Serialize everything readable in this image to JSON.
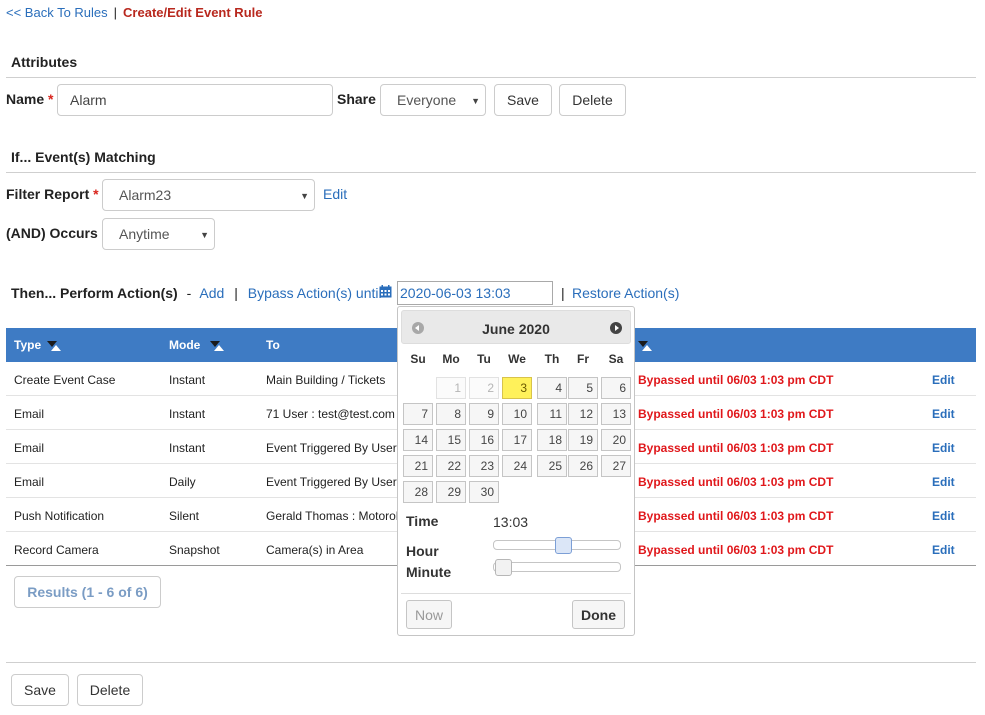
{
  "breadcrumb": {
    "back": "<< Back To Rules",
    "sep": "|",
    "current": "Create/Edit Event Rule"
  },
  "attributes": {
    "title": "Attributes",
    "name_label": "Name",
    "required_mark": "*",
    "name_value": "Alarm",
    "share_label": "Share",
    "share_value": "Everyone",
    "save": "Save",
    "delete": "Delete"
  },
  "matching": {
    "title": "If... Event(s) Matching",
    "filter_label": "Filter Report",
    "filter_value": "Alarm23",
    "edit": "Edit",
    "occurs_label": "(AND) Occurs",
    "occurs_value": "Anytime"
  },
  "actions": {
    "title": "Then... Perform Action(s)",
    "dash": "-",
    "add": "Add",
    "sep": "|",
    "bypass": "Bypass Action(s) until",
    "bypass_value": "2020-06-03 13:03",
    "restore": "Restore Action(s)"
  },
  "table": {
    "columns": {
      "type": "Type",
      "mode": "Mode",
      "to": "To"
    },
    "rows": [
      {
        "type": "Create Event Case",
        "mode": "Instant",
        "to": "Main Building / Tickets",
        "status": "Bypassed until 06/03 1:03 pm CDT",
        "action": "Edit"
      },
      {
        "type": "Email",
        "mode": "Instant",
        "to": "71 User : test@test.com",
        "status": "Bypassed until 06/03 1:03 pm CDT",
        "action": "Edit"
      },
      {
        "type": "Email",
        "mode": "Instant",
        "to": "Event Triggered By User",
        "status": "Bypassed until 06/03 1:03 pm CDT",
        "action": "Edit"
      },
      {
        "type": "Email",
        "mode": "Daily",
        "to": "Event Triggered By User",
        "status": "Bypassed until 06/03 1:03 pm CDT",
        "action": "Edit"
      },
      {
        "type": "Push Notification",
        "mode": "Silent",
        "to": "Gerald Thomas : Motorol",
        "status": "Bypassed until 06/03 1:03 pm CDT",
        "action": "Edit"
      },
      {
        "type": "Record Camera",
        "mode": "Snapshot",
        "to": "Camera(s) in Area",
        "status": "Bypassed until 06/03 1:03 pm CDT",
        "action": "Edit"
      }
    ],
    "results": "Results (1 - 6 of 6)"
  },
  "datepicker": {
    "title": "June 2020",
    "weekdays": [
      "Su",
      "Mo",
      "Tu",
      "We",
      "Th",
      "Fr",
      "Sa"
    ],
    "days": [
      "1",
      "2",
      "3",
      "4",
      "5",
      "6",
      "7",
      "8",
      "9",
      "10",
      "11",
      "12",
      "13",
      "14",
      "15",
      "16",
      "17",
      "18",
      "19",
      "20",
      "21",
      "22",
      "23",
      "24",
      "25",
      "26",
      "27",
      "28",
      "29",
      "30"
    ],
    "time_label": "Time",
    "time_value": "13:03",
    "hour_label": "Hour",
    "minute_label": "Minute",
    "hour_level": 0.55,
    "minute_level": 0.05,
    "now": "Now",
    "done": "Done"
  },
  "footer": {
    "save": "Save",
    "delete": "Delete"
  },
  "colors": {
    "accent": "#3e7bc4",
    "link": "#2a6ebb",
    "required": "#d9251d",
    "bypassed": "#e0171b",
    "today": "#fff15a"
  }
}
